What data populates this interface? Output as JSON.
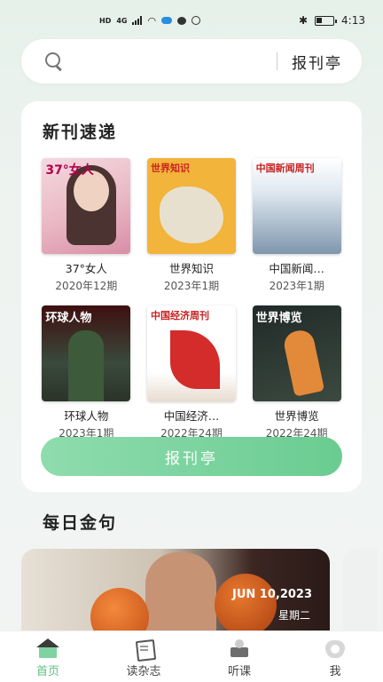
{
  "status_bar": {
    "network": "HD",
    "signal_label": "4G",
    "time": "4:13"
  },
  "search": {
    "placeholder": "",
    "button_label": "报刊亭"
  },
  "new_issues": {
    "title": "新刊速递",
    "magazines": [
      {
        "name": "37°女人",
        "issue": "2020年12期",
        "cover_text": "37°女人"
      },
      {
        "name": "世界知识",
        "issue": "2023年1期",
        "cover_text": "世界知识"
      },
      {
        "name": "中国新闻…",
        "issue": "2023年1期",
        "cover_text": "中国新闻周刊"
      },
      {
        "name": "环球人物",
        "issue": "2023年1期",
        "cover_text": "环球人物"
      },
      {
        "name": "中国经济…",
        "issue": "2022年24期",
        "cover_text": "中国经济周刊"
      },
      {
        "name": "世界博览",
        "issue": "2022年24期",
        "cover_text": "世界博览"
      }
    ],
    "button_label": "报刊亭"
  },
  "daily": {
    "title": "每日金句",
    "date": "JUN 10,2023",
    "weekday": "星期二"
  },
  "tabs": [
    {
      "label": "首页",
      "icon": "home-icon",
      "active": true
    },
    {
      "label": "读杂志",
      "icon": "magazine-icon"
    },
    {
      "label": "听课",
      "icon": "course-icon"
    },
    {
      "label": "我",
      "icon": "profile-icon"
    }
  ],
  "colors": {
    "accent": "#6acc91",
    "active_tab": "#5dbf85"
  }
}
